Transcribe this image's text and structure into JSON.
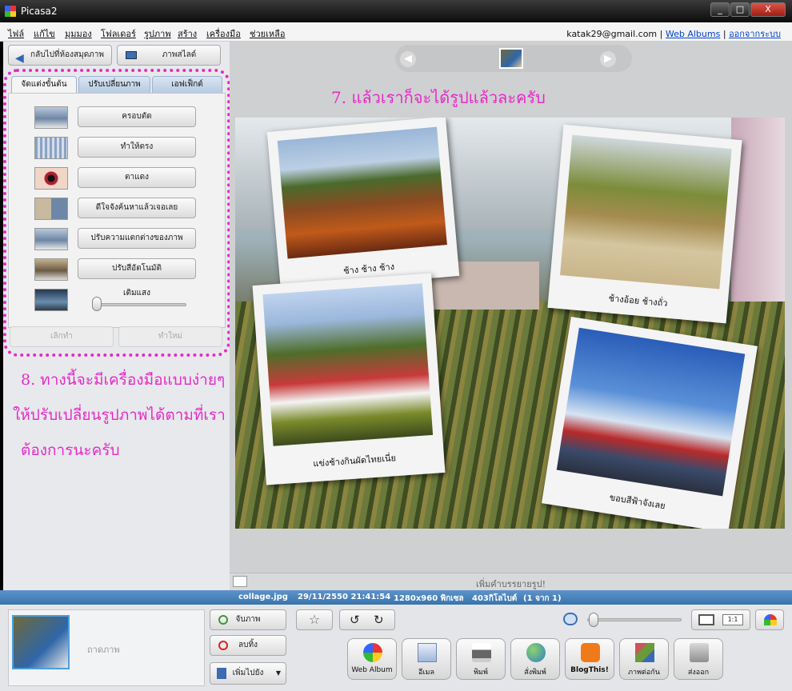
{
  "window": {
    "title": "Picasa2",
    "minimize": "_",
    "maximize": "□",
    "close": "X"
  },
  "menu": [
    "ไฟล์",
    "แก้ไข",
    "มุมมอง",
    "โฟลเดอร์",
    "รูปภาพ",
    "สร้าง",
    "เครื่องมือ",
    "ช่วยเหลือ"
  ],
  "account": {
    "email": "katak29@gmail.com",
    "sep": "|",
    "web_albums": "Web Albums",
    "signout": "ออกจากระบบ"
  },
  "left": {
    "back_button": "กลับไปที่ห้องสมุดภาพ",
    "slideshow_button": "ภาพสไลด์",
    "tabs": [
      "จัดแต่งขั้นต้น",
      "ปรับเปลี่ยนภาพ",
      "เอฟเฟ็กต์"
    ],
    "tools": [
      "ครอบตัด",
      "ทำให้ตรง",
      "ตาแดง",
      "ดีใจจังค้นหาแล้วเจอเลย",
      "ปรับความแตกต่างของภาพ",
      "ปรับสีอัตโนมัติ"
    ],
    "fill_light_label": "เติมแสง",
    "fill_light_value": 0.05,
    "undo": "เลิกทำ",
    "redo": "ทำใหม่"
  },
  "annotations": {
    "a7": "7.  แล้วเราก็จะได้รูปแล้วละครับ",
    "a8_line1": "8.  ทางนี้จะมีเครื่องมือแบบง่ายๆ",
    "a8_line2": "ให้ปรับเปลี่ยนรูปภาพได้ตามที่เรา",
    "a8_line3": "ต้องการนะครับ",
    "color": "#e62ac7"
  },
  "viewer": {
    "captions": [
      "ช้าง ช้าง ช้าง",
      "ช้างอ้อย ช้างถั่ว",
      "แข่งช้างกินผัดไทยเนี่ย",
      "ขอบสีฟ้าจังเลย"
    ],
    "caption_placeholder": "เพิ่มคำบรรยายรูป!"
  },
  "status": {
    "filename": "collage.jpg",
    "datetime": "29/11/2550 21:41:54",
    "dimensions": "1280x960 พิกเซล",
    "size": "403กิโลไบต์",
    "position": "(1 จาก 1)"
  },
  "bottom": {
    "tray_label": "ถาดภาพ",
    "hold": "จับภาพ",
    "clear": "ลบทิ้ง",
    "add_to": "เพิ่มไปยัง",
    "zoom_1to1": "1:1",
    "zoom_level": 0.02,
    "actions": [
      "Web Album",
      "อีเมล",
      "พิมพ์",
      "สั่งพิมพ์",
      "BlogThis!",
      "ภาพต่อกัน",
      "ส่งออก"
    ]
  }
}
